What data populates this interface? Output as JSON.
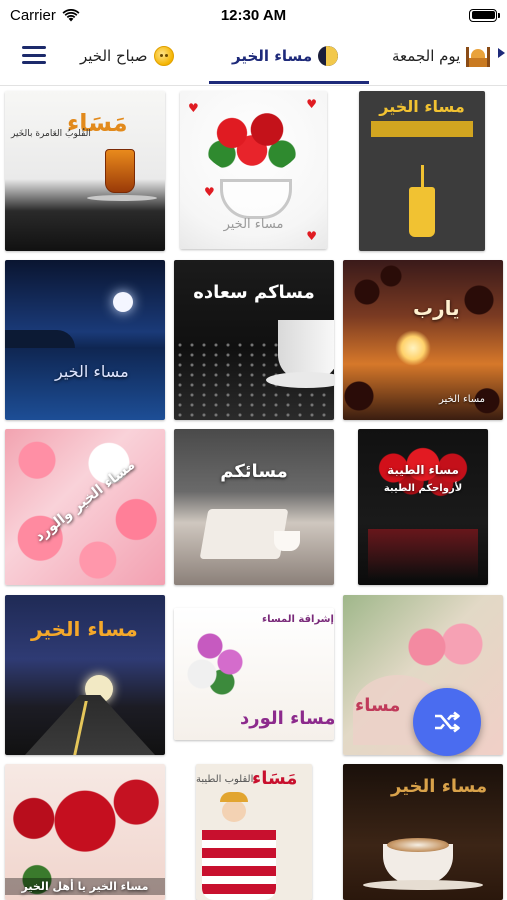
{
  "status_bar": {
    "carrier": "Carrier",
    "time": "12:30 AM",
    "battery_level": 1.0
  },
  "tabs": [
    {
      "label": "صباح الخير",
      "icon": "sun-face-icon",
      "active": false
    },
    {
      "label": "مساء الخير",
      "icon": "crescent-moon-icon",
      "active": true
    },
    {
      "label": "يوم الجمعة",
      "icon": "mosque-icon",
      "active": false
    }
  ],
  "colors": {
    "accent": "#1e2a7a",
    "fab": "#4a6cf0"
  },
  "grid": {
    "items": [
      {
        "caption": "مَسَاء",
        "subcaption": "القُلوبُ العَامرة بالخَير"
      },
      {
        "caption": "مساء الخير",
        "subcaption": ""
      },
      {
        "caption": "مساء الخير",
        "subcaption": ""
      },
      {
        "caption": "مساء الخير",
        "subcaption": ""
      },
      {
        "caption": "مساكم سعاده",
        "subcaption": ""
      },
      {
        "caption": "يارب",
        "subcaption": "مساء الخير"
      },
      {
        "caption": "مساء الخير والورد",
        "subcaption": ""
      },
      {
        "caption": "مسائكم",
        "subcaption": ""
      },
      {
        "caption": "مساء الطيبة",
        "subcaption": "لأرواحكم الطيبة"
      },
      {
        "caption": "مساء الخير",
        "subcaption": ""
      },
      {
        "caption": "مساء الورد",
        "subcaption": "إشراقة المساء"
      },
      {
        "caption": "مساء",
        "subcaption": ""
      },
      {
        "caption": "مساء الخير يا أهل الخير",
        "subcaption": ""
      },
      {
        "caption": "مَسَاء",
        "subcaption": "القلوب الطيبة"
      },
      {
        "caption": "مساء الخير",
        "subcaption": ""
      }
    ]
  },
  "fab": {
    "icon": "shuffle-icon"
  }
}
